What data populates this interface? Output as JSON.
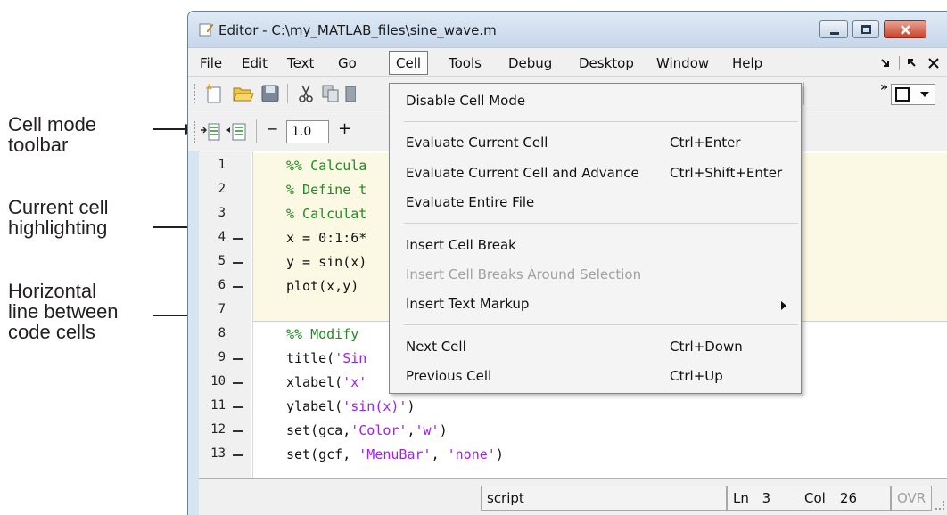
{
  "annotations": {
    "cell_mode_toolbar": [
      "Cell mode",
      "toolbar"
    ],
    "current_cell_highlighting": [
      "Current cell",
      "highlighting"
    ],
    "horizontal_line": [
      "Horizontal",
      "line between",
      "code cells"
    ]
  },
  "window": {
    "title": "Editor - C:\\my_MATLAB_files\\sine_wave.m"
  },
  "menubar": {
    "items": [
      "File",
      "Edit",
      "Text",
      "Go",
      "Cell",
      "Tools",
      "Debug",
      "Desktop",
      "Window",
      "Help"
    ],
    "active": "Cell"
  },
  "cell_toolbar": {
    "minus": "−",
    "value": "1.0",
    "plus": "+"
  },
  "editor": {
    "lines": [
      {
        "num": "1",
        "dash": false,
        "code": "%% Calcula",
        "style": "comment"
      },
      {
        "num": "2",
        "dash": false,
        "code": "% Define t",
        "style": "comment"
      },
      {
        "num": "3",
        "dash": false,
        "code": "% Calculat",
        "style": "comment"
      },
      {
        "num": "4",
        "dash": true,
        "code": "x = 0:1:6*",
        "style": "plain"
      },
      {
        "num": "5",
        "dash": true,
        "code": "y = sin(x)",
        "style": "plain"
      },
      {
        "num": "6",
        "dash": true,
        "code": "plot(x,y)",
        "style": "plain"
      },
      {
        "num": "7",
        "dash": false,
        "code": "",
        "style": "plain"
      },
      {
        "num": "8",
        "dash": false,
        "code": "%% Modify",
        "style": "comment"
      },
      {
        "num": "9",
        "dash": true,
        "code": "title('Sin",
        "style": "mixed"
      },
      {
        "num": "10",
        "dash": true,
        "code": "xlabel('x'",
        "style": "mixed"
      },
      {
        "num": "11",
        "dash": true,
        "code": "ylabel('sin(x)')",
        "style": "mixed"
      },
      {
        "num": "12",
        "dash": true,
        "code": "set(gca,'Color','w')",
        "style": "mixed"
      },
      {
        "num": "13",
        "dash": true,
        "code": "set(gcf, 'MenuBar', 'none')",
        "style": "mixed"
      }
    ]
  },
  "cell_menu": {
    "items": [
      {
        "label": "Disable Cell Mode",
        "shortcut": "",
        "enabled": true
      },
      {
        "label": "Evaluate Current Cell",
        "shortcut": "Ctrl+Enter",
        "enabled": true
      },
      {
        "label": "Evaluate Current Cell and Advance",
        "shortcut": "Ctrl+Shift+Enter",
        "enabled": true
      },
      {
        "label": "Evaluate Entire File",
        "shortcut": "",
        "enabled": true
      },
      {
        "label": "Insert Cell Break",
        "shortcut": "",
        "enabled": true
      },
      {
        "label": "Insert Cell Breaks Around Selection",
        "shortcut": "",
        "enabled": false
      },
      {
        "label": "Insert Text Markup",
        "shortcut": "",
        "enabled": true,
        "submenu": true
      },
      {
        "label": "Next Cell",
        "shortcut": "Ctrl+Down",
        "enabled": true
      },
      {
        "label": "Previous Cell",
        "shortcut": "Ctrl+Up",
        "enabled": true
      }
    ]
  },
  "statusbar": {
    "mode": "script",
    "ln_label": "Ln",
    "ln_value": "3",
    "col_label": "Col",
    "col_value": "26",
    "ovr": "OVR"
  },
  "colors": {
    "comment": "#228b22",
    "string": "#a020f0",
    "cell_highlight": "#fbf9e4"
  }
}
